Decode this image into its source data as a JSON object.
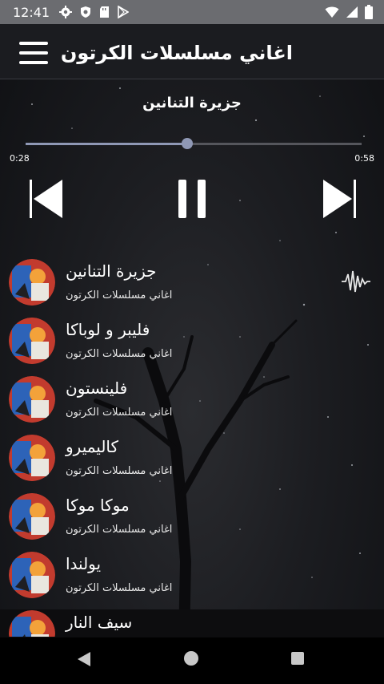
{
  "status_bar": {
    "time": "12:41",
    "left_icons": [
      "gear-icon",
      "shield-icon",
      "sd-card-icon",
      "play-store-icon"
    ],
    "right_icons": [
      "wifi-icon",
      "cell-signal-icon",
      "battery-icon"
    ]
  },
  "app_bar": {
    "title": "اغاني مسلسلات الكرتون",
    "menu_icon": "hamburger-menu-icon"
  },
  "player": {
    "now_playing_title": "جزيرة التنانين",
    "elapsed": "0:28",
    "duration": "0:58",
    "progress_fraction": 0.48,
    "accent_color": "#8f98b5",
    "controls": [
      "skip-previous-icon",
      "pause-icon",
      "skip-next-icon"
    ]
  },
  "songs": [
    {
      "title": "جزيرة  التنانين",
      "artist": "اغاني مسلسلات الكرتون",
      "playing": true
    },
    {
      "title": "فليبر  و  لوباكا",
      "artist": "اغاني مسلسلات الكرتون",
      "playing": false
    },
    {
      "title": "فلينستون",
      "artist": "اغاني مسلسلات الكرتون",
      "playing": false
    },
    {
      "title": "كاليميرو",
      "artist": "اغاني مسلسلات الكرتون",
      "playing": false
    },
    {
      "title": "موكا  موكا",
      "artist": "اغاني مسلسلات الكرتون",
      "playing": false
    },
    {
      "title": "يولندا",
      "artist": "اغاني مسلسلات الكرتون",
      "playing": false
    },
    {
      "title": "سيف  النار",
      "artist": "",
      "playing": false
    }
  ],
  "nav_bar": [
    "back-icon",
    "home-icon",
    "recents-icon"
  ]
}
